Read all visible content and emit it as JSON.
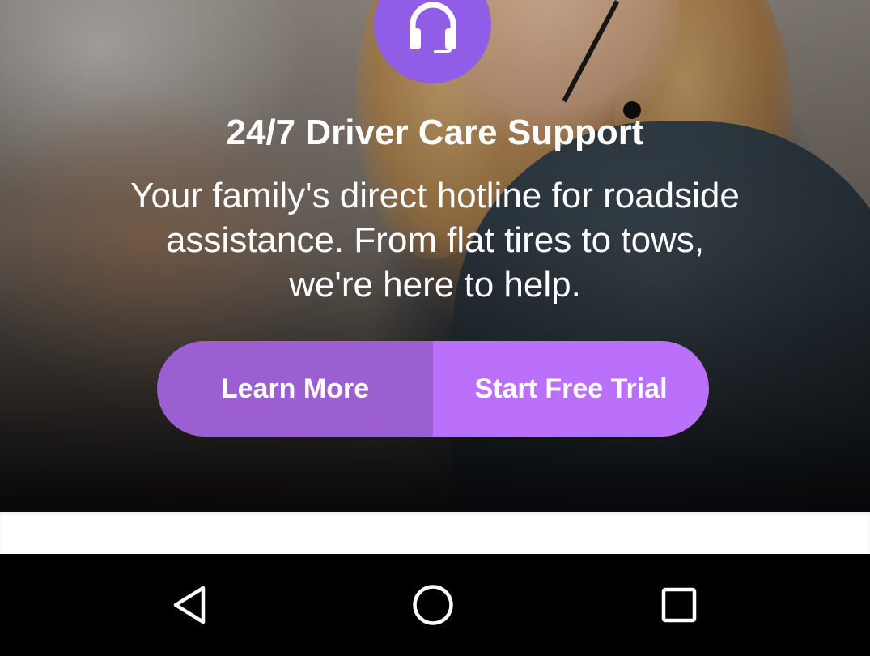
{
  "hero": {
    "icon": "headset-icon",
    "title": "24/7 Driver Care Support",
    "description": "Your family's direct hotline for roadside assistance. From flat tires to tows, we're here to help."
  },
  "actions": {
    "learn_more_label": "Learn More",
    "start_trial_label": "Start Free Trial"
  },
  "nav_bar": {
    "back_icon": "back-triangle-icon",
    "home_icon": "home-circle-icon",
    "recents_icon": "recents-square-icon"
  },
  "colors": {
    "icon_badge": "#8f5de6",
    "learn_more_bg": "#9b5fd2",
    "start_trial_bg": "#bb70fb",
    "nav_bar_bg": "#000000"
  }
}
